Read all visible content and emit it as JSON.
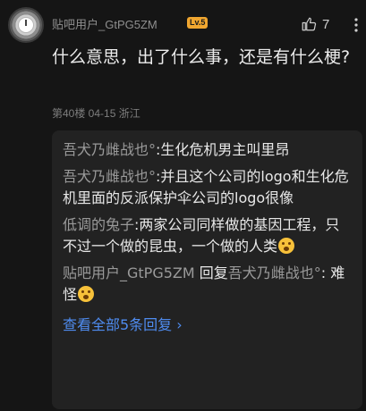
{
  "comment": {
    "username": "贴吧用户_GtPG5ZM",
    "level": "Lv.5",
    "like_count": "7",
    "text": "什么意思，出了什么事，还是有什么梗?",
    "meta": "第40楼 04-15 浙江"
  },
  "replies": [
    {
      "author": "吾犬乃雌战也°",
      "separator": ":",
      "text": "生化危机男主叫里昂",
      "emoji": false
    },
    {
      "author": "吾犬乃雌战也°",
      "separator": ":",
      "text": "并且这个公司的logo和生化危机里面的反派保护伞公司的logo很像",
      "emoji": false
    },
    {
      "author": "低调的兔子",
      "separator": ":",
      "text": "两家公司同样做的基因工程，只不过一个做的昆虫，一个做的人类",
      "emoji": true
    },
    {
      "author": "贴吧用户_GtPG5ZM",
      "connector": "回复",
      "target": "吾犬乃雌战也°",
      "separator": ":",
      "text": "难怪",
      "emoji": true
    }
  ],
  "view_all": "查看全部5条回复",
  "icons": {
    "like": "thumbs-up-outline-icon",
    "more": "vertical-ellipsis-icon",
    "view_all_arrow": "chevron-right-icon",
    "emoji": "grimace-emoji-icon"
  },
  "colors": {
    "background": "#151515",
    "card": "#222222",
    "link": "#4f8cf0",
    "level_badge": "#f0a630"
  }
}
